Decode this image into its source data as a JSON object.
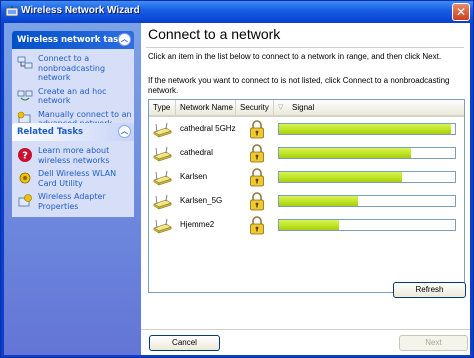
{
  "window": {
    "title": "Wireless Network Wizard",
    "close_label": "✕"
  },
  "sidebar": {
    "tasks_panel": {
      "title": "Wireless network tasks",
      "items": [
        {
          "label": "Connect to a nonbroadcasting network",
          "icon": "network-computers-icon"
        },
        {
          "label": "Create an ad hoc network",
          "icon": "adhoc-computers-icon"
        },
        {
          "label": "Manually connect to an advanced network",
          "icon": "wizard-icon"
        }
      ]
    },
    "related_panel": {
      "title": "Related Tasks",
      "items": [
        {
          "label": "Learn more about wireless networks",
          "icon": "help-icon"
        },
        {
          "label": "Dell Wireless WLAN Card Utility",
          "icon": "utility-icon"
        },
        {
          "label": "Wireless Adapter Properties",
          "icon": "properties-icon"
        }
      ]
    }
  },
  "main": {
    "heading": "Connect to a network",
    "instruction1": "Click an item in the list below to connect to a network in range, and then click Next.",
    "instruction2": "If the network you want to connect to is not listed, click Connect to a nonbroadcasting network.",
    "columns": {
      "type": "Type",
      "name": "Network Name",
      "security": "Security",
      "signal": "Signal"
    },
    "networks": [
      {
        "name": "cathedral 5GHz",
        "secured": true,
        "signal": 0.98
      },
      {
        "name": "cathedral",
        "secured": true,
        "signal": 0.75
      },
      {
        "name": "Karlsen",
        "secured": true,
        "signal": 0.7
      },
      {
        "name": "Karlsen_5G",
        "secured": true,
        "signal": 0.45
      },
      {
        "name": "Hjemme2",
        "secured": true,
        "signal": 0.34
      }
    ],
    "refresh_label": "Refresh",
    "cancel_label": "Cancel",
    "next_label": "Next"
  },
  "colors": {
    "title_blue": "#0c4ad8",
    "signal_green": "#bde21e",
    "link_blue": "#215dc6"
  }
}
